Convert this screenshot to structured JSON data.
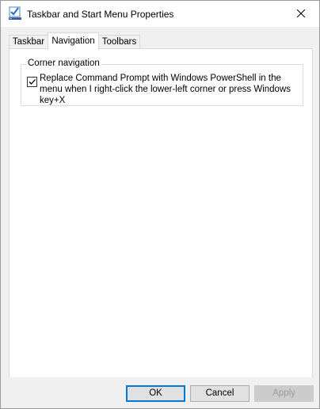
{
  "window": {
    "title": "Taskbar and Start Menu Properties"
  },
  "tabs": [
    {
      "label": "Taskbar",
      "active": false
    },
    {
      "label": "Navigation",
      "active": true
    },
    {
      "label": "Toolbars",
      "active": false
    }
  ],
  "corner_navigation": {
    "legend": "Corner navigation",
    "option_checked": true,
    "option_label": "Replace Command Prompt with Windows PowerShell in the menu when I right-click the lower-left corner or press Windows key+X"
  },
  "buttons": {
    "ok": "OK",
    "cancel": "Cancel",
    "apply": "Apply"
  },
  "icons": {
    "app": "taskbar-properties-icon",
    "close": "close-icon",
    "check": "checkmark-icon"
  },
  "colors": {
    "accent": "#0078d7",
    "window_bg": "#f0f0f0",
    "panel_bg": "#ffffff"
  }
}
